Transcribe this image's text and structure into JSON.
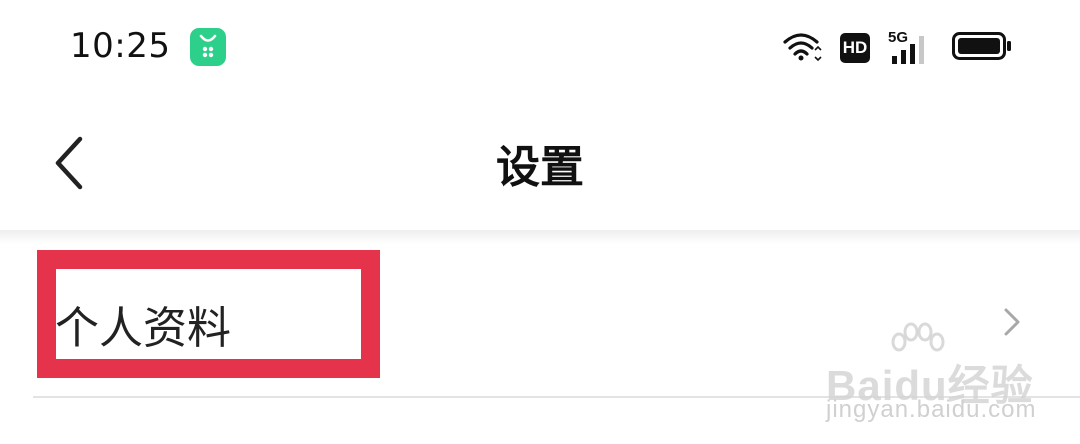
{
  "status_bar": {
    "time": "10:25",
    "app_icon": "green-bag-app-icon",
    "icons": [
      "wifi-icon",
      "hd-icon",
      "5g-signal-icon",
      "battery-icon"
    ],
    "hd_label": "HD",
    "network_label": "5G"
  },
  "header": {
    "back_icon": "back-chevron-icon",
    "title": "设置"
  },
  "list": {
    "items": [
      {
        "label": "个人资料",
        "icon": "chevron-right-icon"
      }
    ]
  },
  "overlay": {
    "highlight_color": "#e5334b"
  },
  "watermark": {
    "logo_text": "Baidu经验",
    "url": "jingyan.baidu.com"
  },
  "colors": {
    "app_icon": "#2dd08a",
    "text": "#222222",
    "chevron": "#a8a8a8"
  }
}
